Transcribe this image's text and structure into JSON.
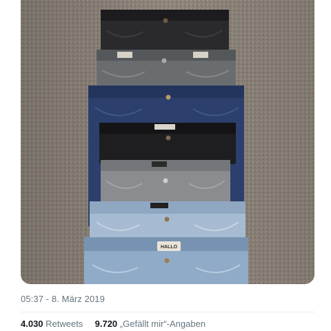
{
  "tweet": {
    "timestamp": "05:37 - 8. März 2019",
    "retweets": {
      "count": "4.030",
      "label": "Retweets"
    },
    "likes": {
      "count": "9.720",
      "label": "„Gefällt mir“-Angaben"
    },
    "media": {
      "subject": "stack-of-folded-jeans",
      "logo_lettering": [
        "HALLO"
      ],
      "colors": {
        "carpet": "#8d8379",
        "black_denim": "#27272a",
        "grey_denim": "#65686b",
        "dark_blue_denim": "#2b3d6b",
        "light_grey_denim": "#8a8b8d",
        "light_blue_denim": "#9fb5cd",
        "bleached_denim": "#8ea9c6"
      }
    }
  }
}
